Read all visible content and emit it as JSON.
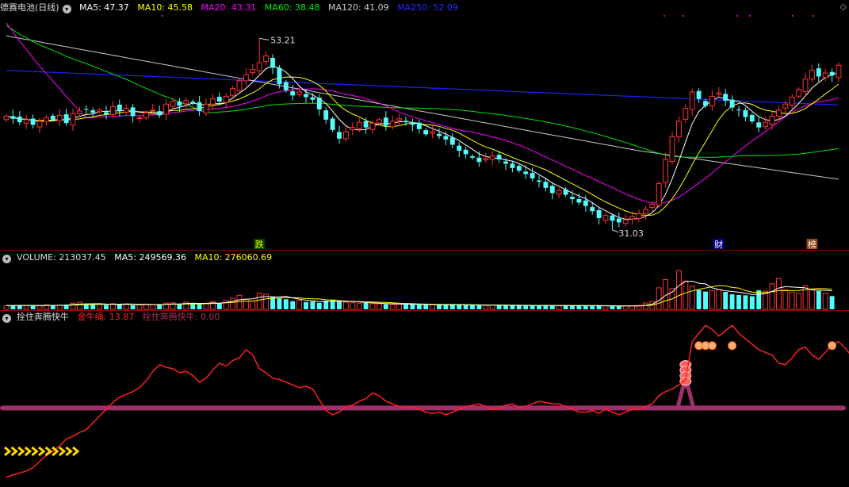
{
  "header": {
    "title": "德赛电池(日线)",
    "ma5": "MA5: 47.37",
    "ma10": "MA10: 45.58",
    "ma20": "MA20: 43.31",
    "ma60": "MA60: 38.48",
    "ma120": "MA120: 41.09",
    "ma250": "MA250: 52.09",
    "corner_icon": "◇"
  },
  "volume_header": {
    "label": "VOLUME: 213037.45",
    "ma5": "MA5: 249569.36",
    "ma10": "MA10: 276060.69"
  },
  "indicator_header": {
    "name": "拴住奔腾快牛",
    "v1": "金牛绳: 13.87",
    "v2": "拴住奔腾快牛: 0.00"
  },
  "colors": {
    "up": "#ff3232",
    "down": "#54fcfc",
    "ma5": "#ffffff",
    "ma10": "#ffff00",
    "ma20": "#ff00ff",
    "ma60": "#00e000",
    "ma120": "#c8c8c8",
    "ma250": "#2020ff",
    "rope": "#a0306a",
    "signal": "#ff2020",
    "separator": "#8b0000"
  },
  "chart_data": [
    {
      "type": "candlestick",
      "title": "德赛电池(日线)",
      "ylim": [
        29,
        56
      ],
      "max_label": "53.21",
      "min_label": "31.03",
      "markers": [
        "跌",
        "财",
        "榜"
      ],
      "closes": [
        44.2,
        43.9,
        43.5,
        43.8,
        43.2,
        43.6,
        44.0,
        43.8,
        44.3,
        43.4,
        44.5,
        44.8,
        45.0,
        44.6,
        44.9,
        44.4,
        45.3,
        44.8,
        45.1,
        44.2,
        44.0,
        44.6,
        44.9,
        44.3,
        45.6,
        45.9,
        45.4,
        46.0,
        45.7,
        44.8,
        45.6,
        46.2,
        45.9,
        46.5,
        47.4,
        48.3,
        49.0,
        49.6,
        50.4,
        51.2,
        49.8,
        47.9,
        47.2,
        46.6,
        47.0,
        46.4,
        46.1,
        45.0,
        43.8,
        42.6,
        41.6,
        42.4,
        42.9,
        43.5,
        42.9,
        43.4,
        43.8,
        43.1,
        43.6,
        43.9,
        43.5,
        43.2,
        42.7,
        42.1,
        42.4,
        41.9,
        41.5,
        40.9,
        40.2,
        39.8,
        39.4,
        38.9,
        39.3,
        39.6,
        39.2,
        38.7,
        38.2,
        37.9,
        37.5,
        37.0,
        36.6,
        35.9,
        35.3,
        35.6,
        35.1,
        34.6,
        34.2,
        33.8,
        33.2,
        32.4,
        32.7,
        32.1,
        31.9,
        32.2,
        32.6,
        32.9,
        33.4,
        34.0,
        36.4,
        39.2,
        41.8,
        43.6,
        45.1,
        47.0,
        46.2,
        45.4,
        46.5,
        46.9,
        46.0,
        45.2,
        44.9,
        44.1,
        43.6,
        42.9,
        43.5,
        44.2,
        44.9,
        45.6,
        46.4,
        47.3,
        48.5,
        49.5,
        48.8,
        49.2,
        48.9,
        50.1
      ],
      "volume": {
        "ylim": [
          0,
          700000
        ],
        "values": [
          60000,
          62000,
          70000,
          58000,
          64000,
          55000,
          72000,
          66000,
          68000,
          75000,
          98000,
          115000,
          84000,
          73000,
          82000,
          69000,
          91000,
          78000,
          88000,
          65000,
          72000,
          84000,
          76000,
          70000,
          99000,
          104000,
          86000,
          115000,
          92000,
          81000,
          99000,
          126000,
          97000,
          142000,
          178000,
          225000,
          164000,
          131000,
          260000,
          242000,
          204000,
          176000,
          162000,
          131000,
          145000,
          118000,
          126000,
          103000,
          139000,
          156000,
          125000,
          115000,
          107000,
          98000,
          104000,
          92000,
          89000,
          84000,
          78000,
          83000,
          86000,
          79000,
          74000,
          77000,
          72000,
          68000,
          73000,
          80000,
          71000,
          69000,
          66000,
          64000,
          62000,
          70000,
          68000,
          61000,
          58000,
          65000,
          60000,
          57000,
          63000,
          66000,
          59000,
          55000,
          58000,
          62000,
          64000,
          56000,
          52000,
          60000,
          54000,
          50000,
          48000,
          55000,
          58000,
          64000,
          102000,
          128000,
          345000,
          478000,
          335000,
          620000,
          455000,
          372000,
          310000,
          285000,
          302000,
          318000,
          280000,
          242000,
          230000,
          225000,
          210000,
          305000,
          292000,
          410000,
          495000,
          315000,
          276000,
          258000,
          380000,
          325000,
          295000,
          262000,
          213037
        ]
      }
    },
    {
      "type": "line",
      "title": "拴住奔腾快牛",
      "series": [
        {
          "name": "金牛绳",
          "values": [
            -10.0,
            -8.5,
            -7.0,
            -5.5,
            -3.0,
            1.5,
            6.0,
            9.0,
            13.0,
            18.0,
            20.0,
            23.0,
            25.0,
            30.0,
            35.0,
            40.0,
            45.0,
            49.0,
            51.0,
            53.0,
            56.0,
            61.0,
            68.0,
            73.0,
            71.0,
            70.0,
            67.0,
            68.0,
            65.0,
            60.0,
            63.0,
            69.0,
            74.0,
            72.0,
            76.0,
            78.0,
            84.0,
            80.0,
            70.0,
            67.0,
            63.0,
            62.0,
            60.0,
            58.0,
            56.0,
            57.0,
            55.0,
            47.0,
            39.0,
            36.0,
            38.0,
            42.0,
            43.0,
            46.0,
            48.0,
            52.0,
            50.0,
            46.0,
            44.0,
            42.0,
            41.0,
            42.0,
            40.0,
            38.0,
            37.0,
            38.0,
            36.0,
            38.0,
            40.0,
            42.0,
            43.0,
            44.0,
            42.0,
            40.0,
            41.0,
            43.0,
            44.0,
            41.0,
            42.0,
            44.0,
            46.0,
            45.0,
            44.0,
            44.0,
            42.0,
            40.0,
            38.0,
            38.0,
            39.0,
            37.0,
            40.0,
            38.0,
            36.0,
            38.0,
            40.0,
            40.0,
            42.0,
            44.0,
            50.0,
            53.0,
            55.0,
            58.0,
            62.0,
            90.0,
            96.0,
            102.0,
            99.0,
            94.0,
            98.0,
            102.0,
            96.0,
            92.0,
            88.0,
            84.0,
            82.0,
            80.0,
            74.0,
            73.0,
            78.0,
            84.0,
            86.0,
            80.0,
            77.0,
            82.0,
            88.0,
            90.0,
            85.0,
            79.0,
            80.0,
            85.0
          ]
        },
        {
          "name": "拴住奔腾快牛",
          "values": [
            0.0
          ]
        }
      ],
      "ylim": [
        -15,
        105
      ]
    }
  ]
}
